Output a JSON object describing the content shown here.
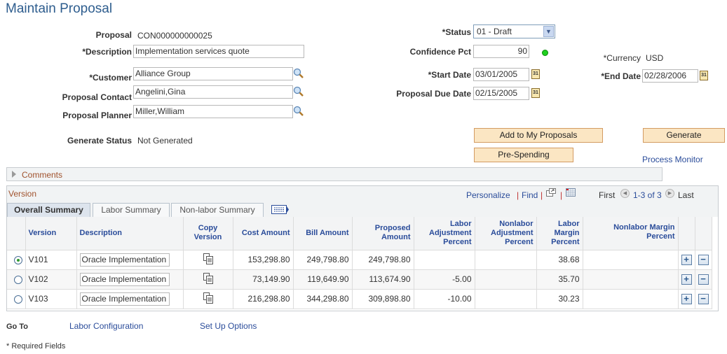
{
  "page": {
    "title": "Maintain Proposal"
  },
  "header_left": {
    "proposal_label": "Proposal",
    "proposal_value": "CON000000000025",
    "description_label": "*Description",
    "description_value": "Implementation services quote",
    "customer_label": "*Customer",
    "customer_value": "Alliance Group",
    "contact_label": "Proposal Contact",
    "contact_value": "Angelini,Gina",
    "planner_label": "Proposal Planner",
    "planner_value": "Miller,William",
    "generate_status_label": "Generate Status",
    "generate_status_value": "Not Generated"
  },
  "header_right": {
    "status_label": "*Status",
    "status_value": "01 - Draft",
    "confidence_label": "Confidence Pct",
    "confidence_value": "90",
    "confidence_indicator_color": "#1fd01f",
    "currency_label": "*Currency",
    "currency_value": "USD",
    "start_date_label": "*Start Date",
    "start_date_value": "03/01/2005",
    "end_date_label": "*End Date",
    "end_date_value": "02/28/2006",
    "due_date_label": "Proposal Due Date",
    "due_date_value": "02/15/2005",
    "calendar_glyph": "31"
  },
  "actions": {
    "add_to_my_proposals": "Add to My Proposals",
    "generate": "Generate",
    "pre_spending": "Pre-Spending",
    "process_monitor": "Process Monitor"
  },
  "comments": {
    "label": "Comments"
  },
  "version_grid": {
    "title": "Version",
    "personalize": "Personalize",
    "find": "Find",
    "separator": "|",
    "first": "First",
    "range": "1-3 of 3",
    "last": "Last",
    "tabs": [
      {
        "label": "Overall Summary",
        "active": true
      },
      {
        "label": "Labor Summary",
        "active": false
      },
      {
        "label": "Non-labor Summary",
        "active": false
      }
    ],
    "columns": [
      "",
      "Version",
      "Description",
      "Copy Version",
      "Cost Amount",
      "Bill Amount",
      "Proposed Amount",
      "Labor Adjustment Percent",
      "Nonlabor Adjustment Percent",
      "Labor Margin Percent",
      "Nonlabor Margin Percent",
      "",
      ""
    ],
    "rows": [
      {
        "selected": true,
        "version": "V101",
        "description": "Oracle Implementation",
        "cost": "153,298.80",
        "bill": "249,798.80",
        "proposed": "249,798.80",
        "labor_adj": "",
        "nonlabor_adj": "",
        "labor_margin": "38.68",
        "nonlabor_margin": ""
      },
      {
        "selected": false,
        "version": "V102",
        "description": "Oracle Implementation",
        "cost": "73,149.90",
        "bill": "119,649.90",
        "proposed": "113,674.90",
        "labor_adj": "-5.00",
        "nonlabor_adj": "",
        "labor_margin": "35.70",
        "nonlabor_margin": ""
      },
      {
        "selected": false,
        "version": "V103",
        "description": "Oracle Implementation",
        "cost": "216,298.80",
        "bill": "344,298.80",
        "proposed": "309,898.80",
        "labor_adj": "-10.00",
        "nonlabor_adj": "",
        "labor_margin": "30.23",
        "nonlabor_margin": ""
      }
    ],
    "add_row_glyph": "+",
    "delete_row_glyph": "−"
  },
  "footer": {
    "goto_label": "Go To",
    "labor_configuration": "Labor Configuration",
    "set_up_options": "Set Up Options",
    "required_note": "* Required Fields"
  }
}
